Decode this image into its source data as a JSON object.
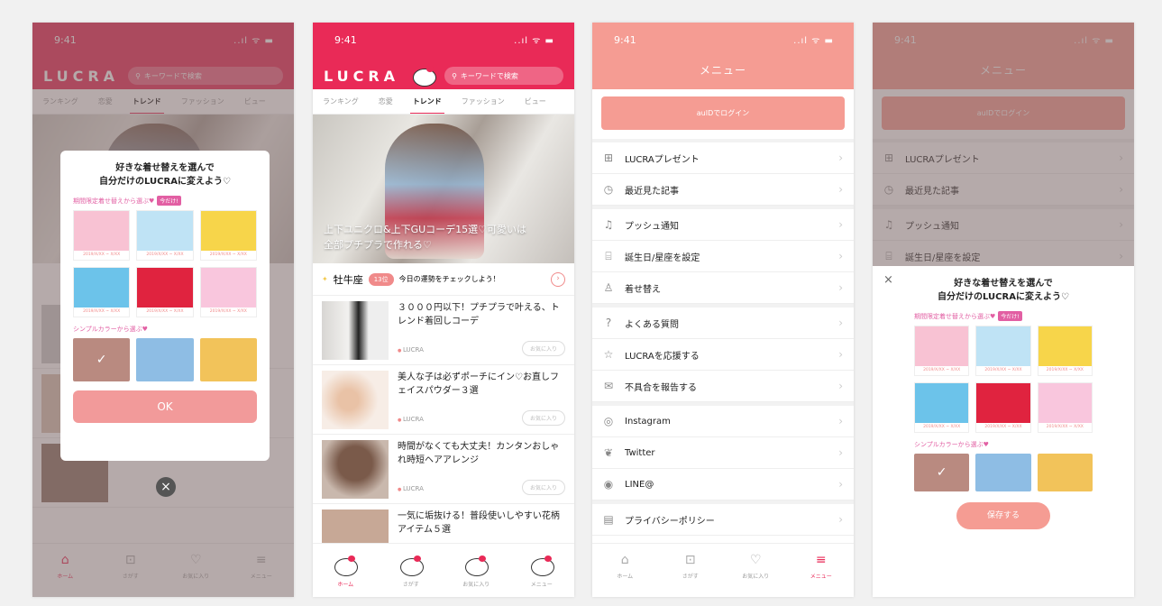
{
  "status": {
    "time": "9:41",
    "icons": "..ıl ᯤ ▬"
  },
  "app": {
    "logo": "LUCRA",
    "search_placeholder": "キーワードで検索"
  },
  "tabs": [
    "ランキング",
    "恋愛",
    "トレンド",
    "ファッション",
    "ビュー"
  ],
  "hero": {
    "caption_line1": "上下ユニクロ&上下GUコーデ15選♡可愛いは",
    "caption_line2": "全部プチプラで作れる♡"
  },
  "zodiac": {
    "name": "牡牛座",
    "rank": "13位",
    "text": "今日の運勢をチェックしよう！"
  },
  "articles": [
    {
      "title": "３０００円以下！プチプラで叶える、トレンド着回しコーデ",
      "source": "LUCRA",
      "fav": "お気に入り"
    },
    {
      "title": "美人な子は必ずポーチにイン♡お直しフェイスパウダー３選",
      "source": "LUCRA",
      "fav": "お気に入り"
    },
    {
      "title": "時間がなくても大丈夫！カンタンおしゃれ時短ヘアアレンジ",
      "source": "LUCRA",
      "fav": "お気に入り"
    },
    {
      "title": "一気に垢抜ける！普段使いしやすい花柄アイテム５選",
      "source": "LUCRA",
      "fav": "お気に入り"
    }
  ],
  "nav": [
    "ホーム",
    "さがす",
    "お気に入り",
    "メニュー"
  ],
  "modal": {
    "title_line1": "好きな着せ替えを選んで",
    "title_line2": "自分だけのLUCRAに変えよう♡",
    "limited_label": "期間限定着せ替えから選ぶ♥",
    "limited_badge": "今だけ!",
    "date": "2019/X/XX ~ X/XX",
    "simple_label": "シンプルカラーから選ぶ♥",
    "ok": "OK",
    "save": "保存する",
    "close": "×",
    "check": "✓"
  },
  "menu": {
    "title": "メニュー",
    "login": "auIDでログイン",
    "items": [
      {
        "label": "LUCRAプレゼント",
        "icon": "gift-icon"
      },
      {
        "label": "最近見た記事",
        "icon": "clock-icon"
      },
      {
        "label": "プッシュ通知",
        "icon": "bell-icon"
      },
      {
        "label": "誕生日/星座を設定",
        "icon": "cake-icon"
      },
      {
        "label": "着せ替え",
        "icon": "shirt-icon"
      },
      {
        "label": "よくある質問",
        "icon": "question-icon"
      },
      {
        "label": "LUCRAを応援する",
        "icon": "star-icon"
      },
      {
        "label": "不具合を報告する",
        "icon": "mail-icon"
      },
      {
        "label": "Instagram",
        "icon": "instagram-icon"
      },
      {
        "label": "Twitter",
        "icon": "twitter-icon"
      },
      {
        "label": "LINE@",
        "icon": "line-icon"
      },
      {
        "label": "プライバシーポリシー",
        "icon": "document-icon"
      }
    ]
  },
  "colors": {
    "brand_red": "#e92a57",
    "salmon": "#f59c93",
    "pink_label": "#e25fa3"
  }
}
